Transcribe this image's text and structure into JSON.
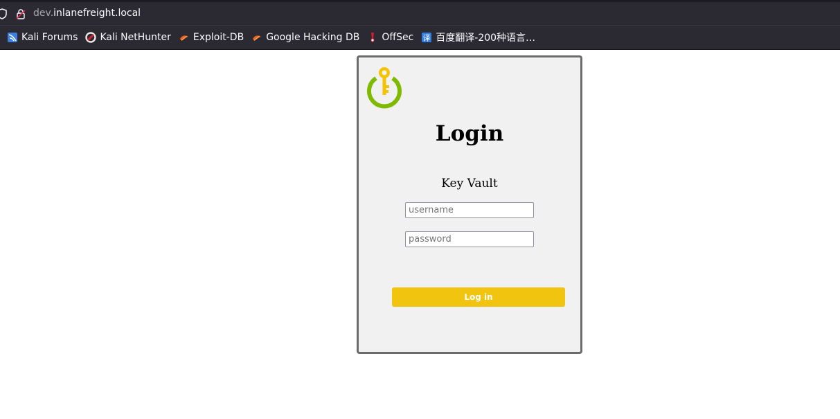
{
  "browser": {
    "url_subdomain": "dev.",
    "url_domain": "inlanefreight.local",
    "bookmarks": [
      {
        "label": "Kali Forums",
        "icon": "kali-forums-icon"
      },
      {
        "label": "Kali NetHunter",
        "icon": "kali-nethunter-icon"
      },
      {
        "label": "Exploit-DB",
        "icon": "exploit-db-icon"
      },
      {
        "label": "Google Hacking DB",
        "icon": "google-hacking-db-icon"
      },
      {
        "label": "OffSec",
        "icon": "offsec-icon"
      },
      {
        "label": "百度翻译-200种语言…",
        "icon": "baidu-translate-icon"
      }
    ]
  },
  "login": {
    "title": "Login",
    "subtitle": "Key Vault",
    "username_placeholder": "username",
    "password_placeholder": "password",
    "button_label": "Log in"
  },
  "colors": {
    "button": "#f1c40f",
    "logo_ring": "#7fba00",
    "logo_key": "#f5c400",
    "card_background": "#f1f1f1",
    "card_border": "#6b6b6b"
  }
}
